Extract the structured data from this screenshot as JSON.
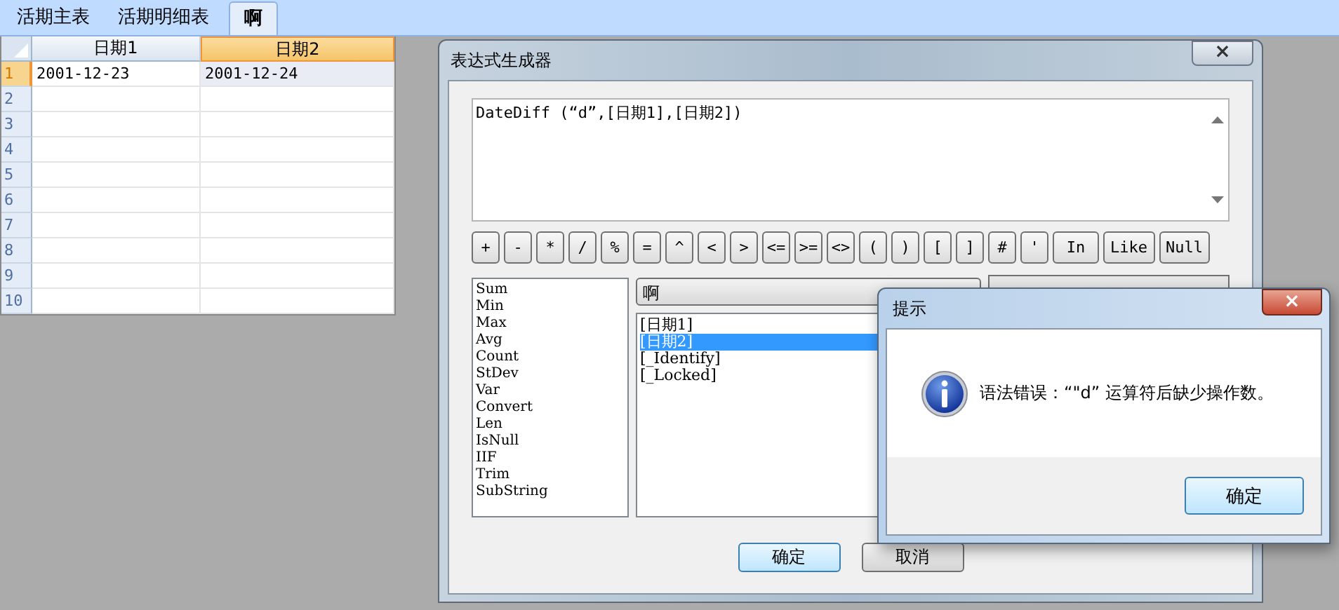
{
  "tabs": [
    {
      "label": "活期主表",
      "selected": false
    },
    {
      "label": "活期明细表",
      "selected": false
    },
    {
      "label": "啊",
      "selected": true
    }
  ],
  "grid": {
    "columns": [
      {
        "label": "日期1",
        "selected": false
      },
      {
        "label": "日期2",
        "selected": true
      }
    ],
    "rows": [
      {
        "number": "1",
        "selected": true,
        "cells": [
          "2001-12-23",
          "2001-12-24"
        ]
      },
      {
        "number": "2",
        "selected": false,
        "cells": []
      },
      {
        "number": "3",
        "selected": false,
        "cells": []
      },
      {
        "number": "4",
        "selected": false,
        "cells": []
      },
      {
        "number": "5",
        "selected": false,
        "cells": []
      },
      {
        "number": "6",
        "selected": false,
        "cells": []
      },
      {
        "number": "7",
        "selected": false,
        "cells": []
      },
      {
        "number": "8",
        "selected": false,
        "cells": []
      },
      {
        "number": "9",
        "selected": false,
        "cells": []
      },
      {
        "number": "10",
        "selected": false,
        "cells": []
      }
    ]
  },
  "dialog": {
    "title": "表达式生成器",
    "close": "×",
    "expression": "DateDiff (“d”,[日期1],[日期2])",
    "operators": [
      "+",
      "-",
      "*",
      "/",
      "%",
      "=",
      "^",
      "<",
      ">",
      "<=",
      ">=",
      "<>",
      "(",
      ")",
      "[",
      "]",
      "#",
      "'",
      "In",
      "Like",
      "Null"
    ],
    "functions": [
      "Sum",
      "Min",
      "Max",
      "Avg",
      "Count",
      "StDev",
      "Var",
      "Convert",
      "Len",
      "IsNull",
      "IIF",
      "Trim",
      "SubString"
    ],
    "table_combo": "啊",
    "fields": [
      {
        "label": "[日期1]",
        "selected": false
      },
      {
        "label": "[日期2]",
        "selected": true
      },
      {
        "label": "[_Identify]",
        "selected": false
      },
      {
        "label": "[_Locked]",
        "selected": false
      }
    ],
    "buttons": [
      {
        "label": "确定",
        "default": true
      },
      {
        "label": "取消",
        "default": false
      }
    ]
  },
  "message_box": {
    "title": "提示",
    "close": "×",
    "message": "语法错误：“\"d” 运算符后缺少操作数。",
    "button": "确定"
  }
}
